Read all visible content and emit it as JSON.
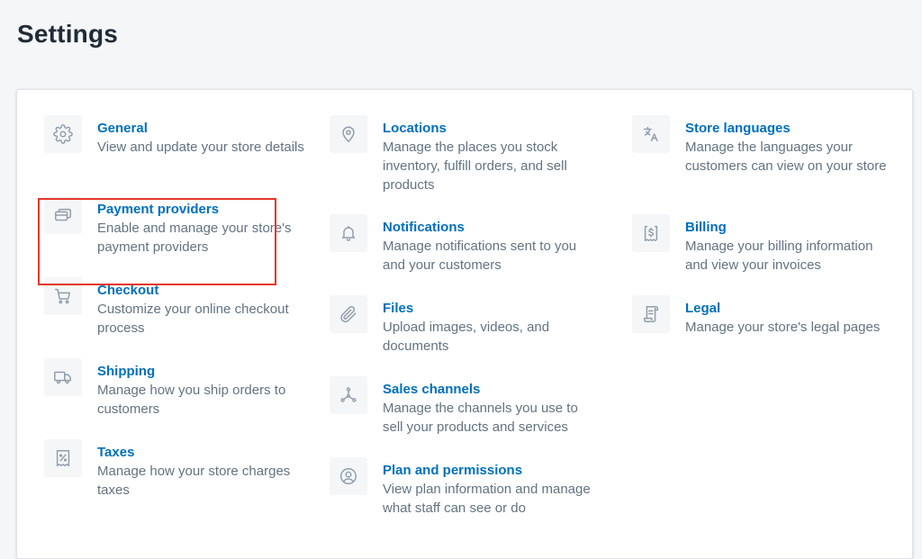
{
  "page": {
    "title": "Settings"
  },
  "columns": [
    [
      {
        "title": "General",
        "desc": "View and update your store details",
        "icon": "gear-icon"
      },
      {
        "title": "Payment providers",
        "desc": "Enable and manage your store's payment providers",
        "icon": "payment-icon"
      },
      {
        "title": "Checkout",
        "desc": "Customize your online checkout process",
        "icon": "cart-icon"
      },
      {
        "title": "Shipping",
        "desc": "Manage how you ship orders to customers",
        "icon": "truck-icon"
      },
      {
        "title": "Taxes",
        "desc": "Manage how your store charges taxes",
        "icon": "tax-receipt-icon"
      }
    ],
    [
      {
        "title": "Locations",
        "desc": "Manage the places you stock inventory, fulfill orders, and sell products",
        "icon": "location-pin-icon"
      },
      {
        "title": "Notifications",
        "desc": "Manage notifications sent to you and your customers",
        "icon": "bell-icon"
      },
      {
        "title": "Files",
        "desc": "Upload images, videos, and documents",
        "icon": "paperclip-icon"
      },
      {
        "title": "Sales channels",
        "desc": "Manage the channels you use to sell your products and services",
        "icon": "channels-icon"
      },
      {
        "title": "Plan and permissions",
        "desc": "View plan information and manage what staff can see or do",
        "icon": "user-circle-icon"
      }
    ],
    [
      {
        "title": "Store languages",
        "desc": "Manage the languages your customers can view on your store",
        "icon": "translate-icon"
      },
      {
        "title": "Billing",
        "desc": "Manage your billing information and view your invoices",
        "icon": "invoice-dollar-icon"
      },
      {
        "title": "Legal",
        "desc": "Manage your store's legal pages",
        "icon": "legal-document-icon"
      }
    ]
  ],
  "colors": {
    "link": "#006fbb",
    "description": "#637381",
    "icon": "#919eab",
    "highlight": "#e5362a"
  }
}
